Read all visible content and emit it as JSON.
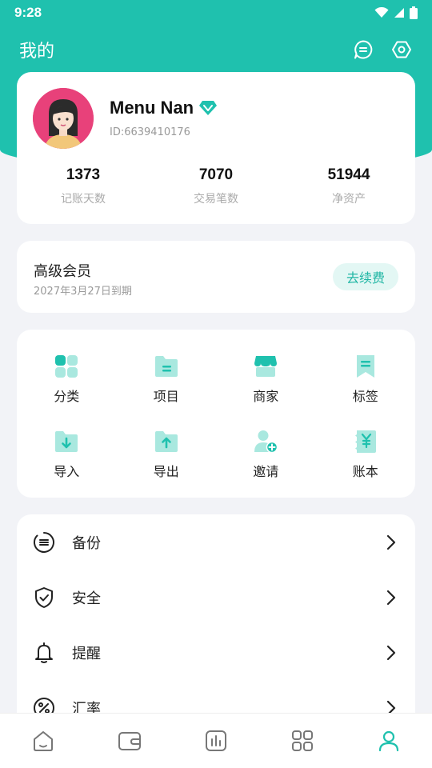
{
  "status_bar": {
    "time": "9:28"
  },
  "header": {
    "title": "我的",
    "message_icon": "message-icon",
    "settings_icon": "settings-icon"
  },
  "profile": {
    "name": "Menu Nan",
    "id": "ID:6639410176",
    "vip_icon": "diamond-icon",
    "stats": [
      {
        "value": "1373",
        "label": "记账天数"
      },
      {
        "value": "7070",
        "label": "交易笔数"
      },
      {
        "value": "51944",
        "label": "净资产"
      }
    ]
  },
  "membership": {
    "title": "高级会员",
    "expiry": "2027年3月27日到期",
    "renew_label": "去续费"
  },
  "shortcuts": [
    {
      "label": "分类",
      "icon": "category-icon"
    },
    {
      "label": "项目",
      "icon": "project-icon"
    },
    {
      "label": "商家",
      "icon": "merchant-icon"
    },
    {
      "label": "标签",
      "icon": "tag-icon"
    },
    {
      "label": "导入",
      "icon": "import-icon"
    },
    {
      "label": "导出",
      "icon": "export-icon"
    },
    {
      "label": "邀请",
      "icon": "invite-icon"
    },
    {
      "label": "账本",
      "icon": "ledger-icon"
    }
  ],
  "menu": [
    {
      "label": "备份",
      "icon": "backup-icon"
    },
    {
      "label": "安全",
      "icon": "shield-icon"
    },
    {
      "label": "提醒",
      "icon": "bell-icon"
    },
    {
      "label": "汇率",
      "icon": "percent-icon"
    }
  ],
  "tab_bar": {
    "tabs": [
      "home-icon",
      "wallet-icon",
      "chart-icon",
      "apps-icon",
      "profile-icon"
    ],
    "active": 4
  },
  "colors": {
    "accent": "#1fc1ae",
    "accent_light": "#a9e8df",
    "background": "#f2f3f7"
  }
}
